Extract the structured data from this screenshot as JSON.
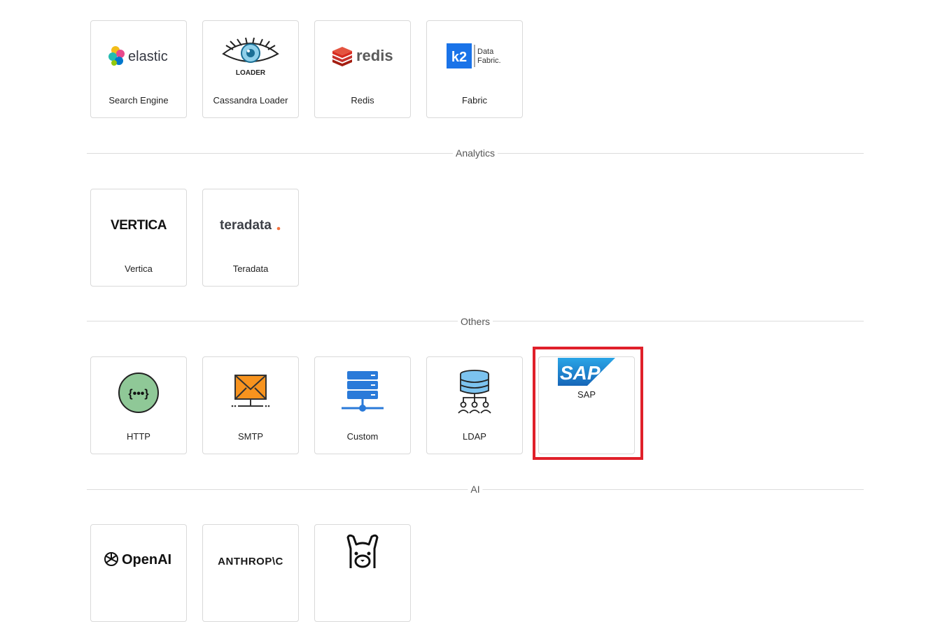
{
  "sections": {
    "analytics": "Analytics",
    "others": "Others",
    "ai": "AI"
  },
  "cards": {
    "search_engine": {
      "label": "Search Engine",
      "logo_text": "elastic"
    },
    "cassandra_loader": {
      "label": "Cassandra Loader",
      "logo_text": "LOADER"
    },
    "redis": {
      "label": "Redis",
      "logo_text": "redis"
    },
    "fabric": {
      "label": "Fabric",
      "logo_text_1": "Data",
      "logo_text_2": "Fabric."
    },
    "vertica": {
      "label": "Vertica",
      "logo_text": "VERTICA"
    },
    "teradata": {
      "label": "Teradata",
      "logo_text": "teradata"
    },
    "http": {
      "label": "HTTP"
    },
    "smtp": {
      "label": "SMTP"
    },
    "custom": {
      "label": "Custom"
    },
    "ldap": {
      "label": "LDAP"
    },
    "sap": {
      "label": "SAP",
      "logo_text": "SAP"
    },
    "openai": {
      "logo_text": "OpenAI"
    },
    "anthropic": {
      "logo_text": "ANTHROP\\C"
    }
  },
  "colors": {
    "highlight": "#e0202a",
    "card_border": "#d9d9d9",
    "divider": "#dcdcdc"
  }
}
